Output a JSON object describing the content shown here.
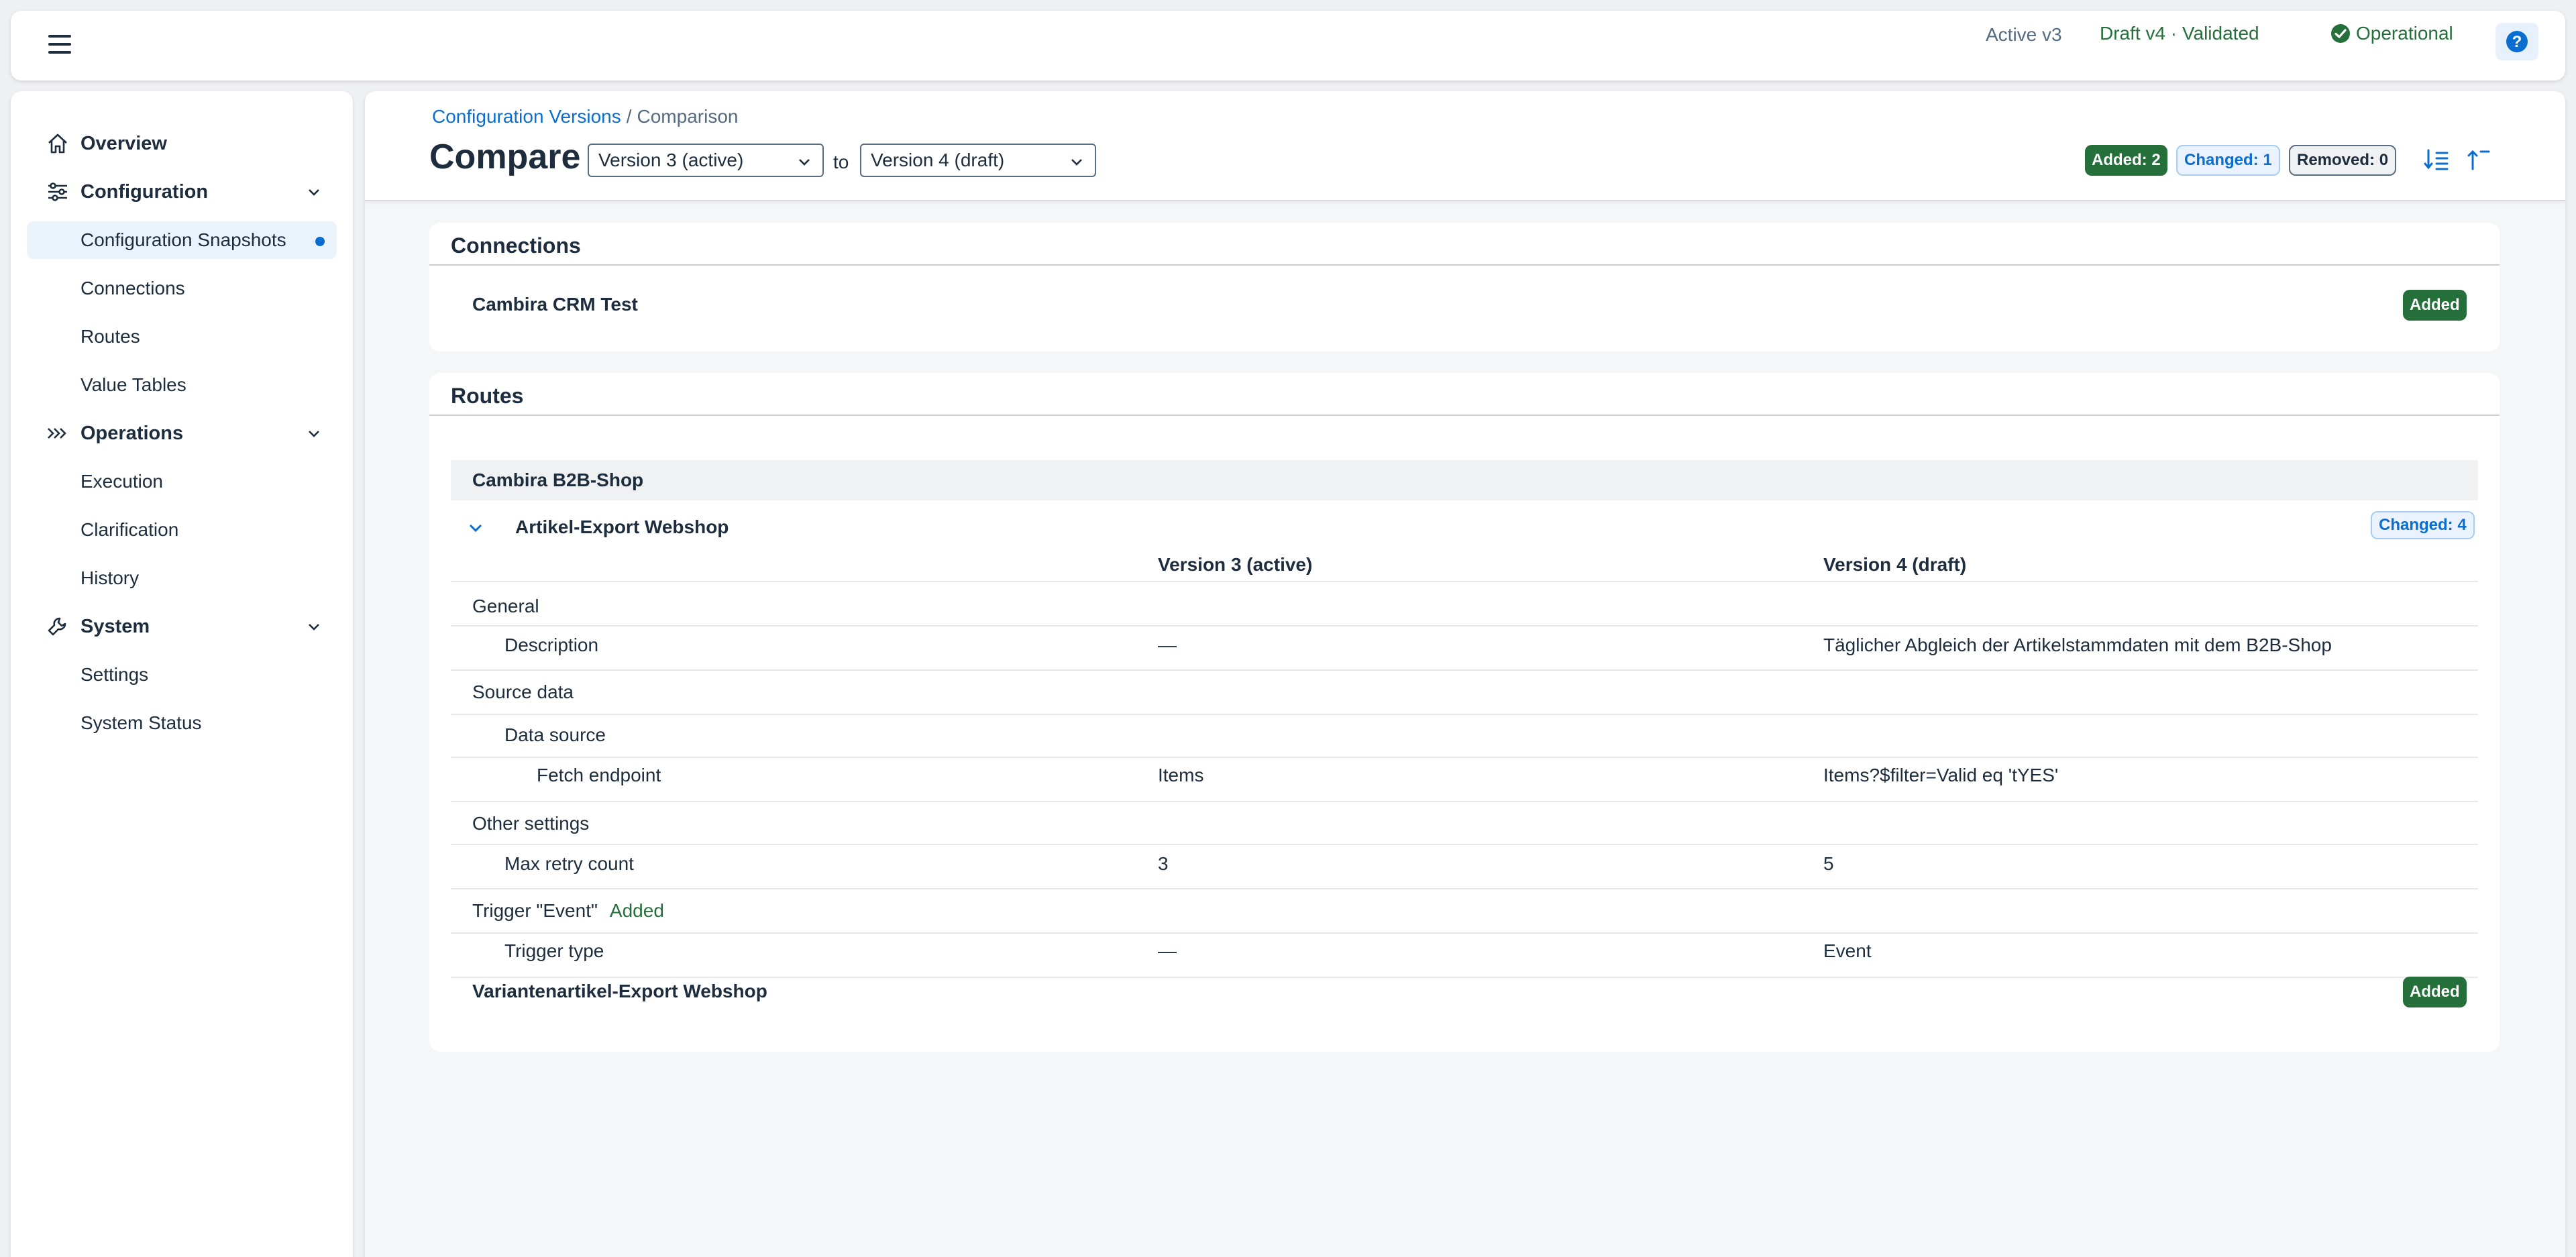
{
  "shell": {
    "active_label": "Active v3",
    "draft_label": "Draft v4 · Validated",
    "status_label": "Operational",
    "colors": {
      "success": "#256f3a",
      "accent": "#0a6ed1"
    }
  },
  "sidebar": {
    "items": [
      {
        "label": "Overview",
        "icon": "home-icon"
      },
      {
        "label": "Configuration",
        "icon": "sliders-icon"
      },
      {
        "label": "Configuration Snapshots"
      },
      {
        "label": "Connections"
      },
      {
        "label": "Routes"
      },
      {
        "label": "Value Tables"
      },
      {
        "label": "Operations",
        "icon": "chevrons-right-icon"
      },
      {
        "label": "Execution"
      },
      {
        "label": "Clarification"
      },
      {
        "label": "History"
      },
      {
        "label": "System",
        "icon": "wrench-icon"
      },
      {
        "label": "Settings"
      },
      {
        "label": "System Status"
      }
    ]
  },
  "header": {
    "breadcrumb": {
      "link": "Configuration Versions",
      "separator": "/",
      "current": "Comparison"
    },
    "title": "Compare",
    "from_select": "Version 3 (active)",
    "to_label": "to",
    "to_select": "Version 4 (draft)",
    "badges": {
      "added": "Added: 2",
      "changed": "Changed: 1",
      "removed": "Removed: 0"
    }
  },
  "connections": {
    "title": "Connections",
    "item": {
      "name": "Cambira CRM Test",
      "status": "Added"
    }
  },
  "routes": {
    "title": "Routes",
    "group": "Cambira B2B-Shop",
    "route": {
      "name": "Artikel-Export Webshop",
      "status": "Changed: 4"
    },
    "columns": {
      "from": "Version 3 (active)",
      "to": "Version 4 (draft)"
    },
    "rows": [
      {
        "label": "General"
      },
      {
        "label": "Description",
        "from": "—",
        "to": "Täglicher Abgleich der Artikelstammdaten mit dem B2B-Shop"
      },
      {
        "label": "Source data"
      },
      {
        "label": "Data source"
      },
      {
        "label": "Fetch endpoint",
        "from": "Items",
        "to": "Items?$filter=Valid eq 'tYES'"
      },
      {
        "label": "Other settings"
      },
      {
        "label": "Max retry count",
        "from": "3",
        "to": "5"
      },
      {
        "label": "Trigger \"Event\"",
        "note": "Added"
      },
      {
        "label": "Trigger type",
        "from": "—",
        "to": "Event"
      }
    ],
    "other_route": {
      "name": "Variantenartikel-Export Webshop",
      "status": "Added"
    }
  }
}
